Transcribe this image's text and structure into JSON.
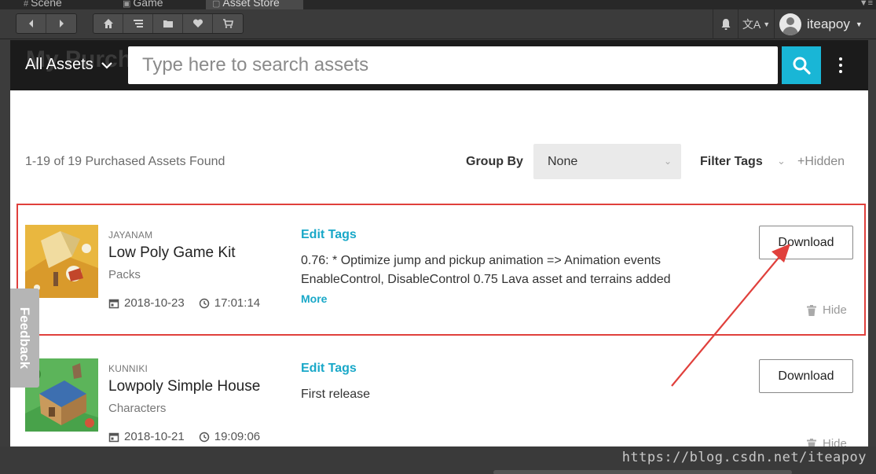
{
  "editor_tabs": [
    {
      "label": "Scene",
      "glyph": "#"
    },
    {
      "label": "Game",
      "glyph": "▣"
    },
    {
      "label": "Asset Store",
      "glyph": "▢"
    }
  ],
  "toolbar": {
    "user_name": "iteapoy",
    "icons": [
      "back-arrow-icon",
      "forward-arrow-icon",
      "home-icon",
      "menu-icon",
      "folder-icon",
      "heart-icon",
      "cart-icon",
      "bell-icon",
      "translate-icon"
    ],
    "lang_glyph": "文A"
  },
  "page": {
    "ghost_title": "My Purchases",
    "scope_label": "All Assets",
    "search_placeholder": "Type here to search assets",
    "results_count": "1-19 of 19 Purchased Assets Found",
    "group_by_label": "Group By",
    "group_by_value": "None",
    "filter_tags_label": "Filter Tags",
    "hidden_toggle": "+Hidden",
    "feedback_label": "Feedback"
  },
  "assets": [
    {
      "publisher": "JAYANAM",
      "title": "Low Poly Game Kit",
      "category": "Packs",
      "date": "2018-10-23",
      "time": "17:01:14",
      "edit_tags": "Edit Tags",
      "notes": "0.76: * Optimize jump and pickup animation => Animation events EnableControl, DisableControl 0.75 Lava asset and terrains added",
      "more": "More",
      "download": "Download",
      "hide": "Hide"
    },
    {
      "publisher": "KUNNIKI",
      "title": "Lowpoly Simple House",
      "category": "Characters",
      "date": "2018-10-21",
      "time": "19:09:06",
      "edit_tags": "Edit Tags",
      "notes": "First release",
      "more": "",
      "download": "Download",
      "hide": "Hide"
    }
  ],
  "watermark": "https://blog.csdn.net/iteapoy",
  "colors": {
    "accent": "#19b6d6",
    "link": "#19a8c8",
    "annotation": "#e0403c"
  }
}
